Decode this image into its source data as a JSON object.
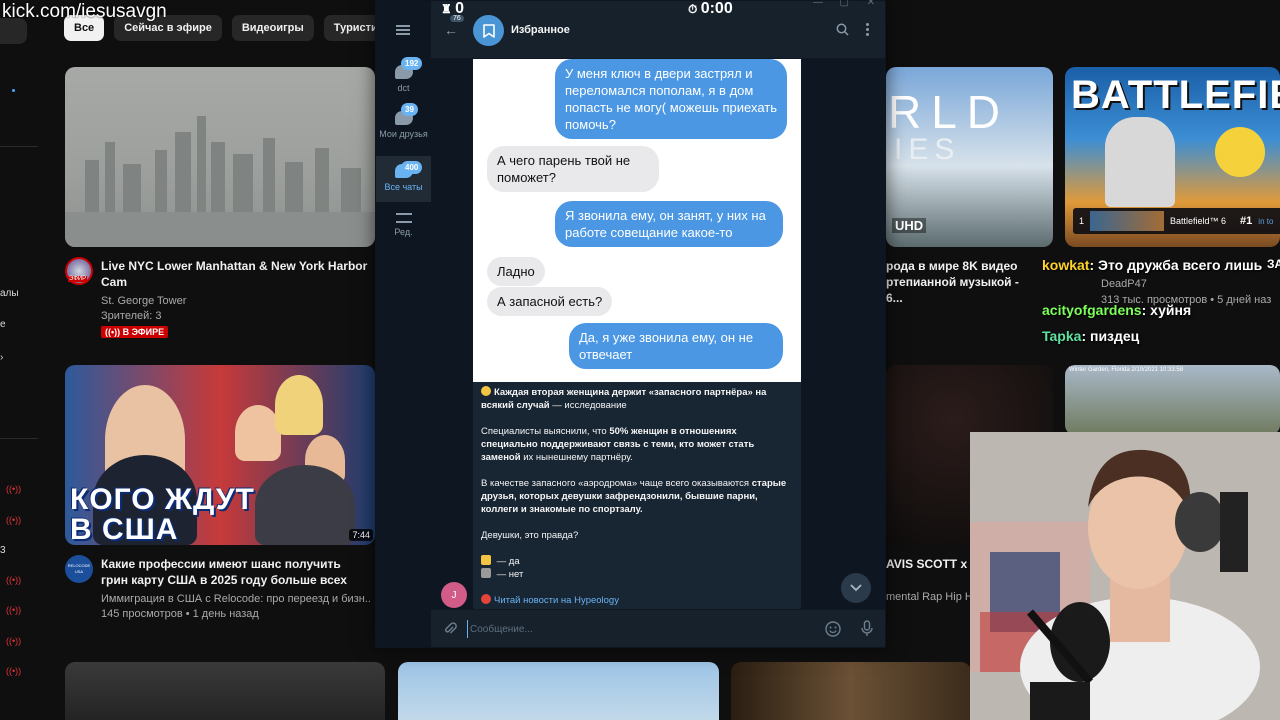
{
  "watermark": "kick.com/iesusavgn",
  "chips": [
    "Все",
    "Сейчас в эфире",
    "Видеоигры",
    "Туристическ"
  ],
  "rail": {
    "label_1": "алы",
    "label_2": "е",
    "label_3": "3"
  },
  "videos": [
    {
      "title": "Live NYC Lower Manhattan & New York Harbor Cam",
      "channel": "St. George Tower",
      "meta": "Зрителей: 3",
      "live_label": "((•)) В ЭФИРЕ",
      "avatar_label": "ЭФИР"
    },
    {
      "title": "Какие профессии имеют шанс получить грин карту США в 2025 году больше всех",
      "channel": "Иммиграция в США с Relocode: про переезд и бизн...",
      "meta": "145 просмотров • 1 день назад",
      "duration": "7:44",
      "thumb_text_1": "КОГО ЖДУТ",
      "thumb_text_2": "В США",
      "avatar_label": "RELOCODE USA"
    },
    {
      "title_partial": "рода в мире 8K видео ртепианной музыкой - 6...",
      "channel": "DeadP47",
      "meta": "313 тыс. просмотров • 5 дней наз",
      "thumb_text_1": "RLD",
      "thumb_text_2": "IES",
      "uhd": "UHD"
    },
    {
      "thumb_title": "BATTLEFIE",
      "rank": "1",
      "game": "Battlefield™ 6",
      "place": "#1",
      "place_suffix": "in to"
    },
    {
      "title_partial": "AVIS SCOTT x D",
      "meta_partial": "mental Rap Hip H"
    }
  ],
  "thumb_caption": "Winter Garden, Florida   2/10/2021 10:33:58",
  "chat": [
    {
      "user": "kowkat",
      "text": ": Это дружба всего лишь",
      "extra": "ЗА"
    },
    {
      "user": "acityofgardens",
      "text": ": хуйня"
    },
    {
      "user": "Tapka",
      "text": ": пиздец"
    }
  ],
  "overlay": {
    "counter": "0",
    "timer": "0:00"
  },
  "telegram": {
    "header_title": "Избранное",
    "back_badge": "76",
    "folders": [
      {
        "label": "dct",
        "badge": "192"
      },
      {
        "label": "Мои друзья",
        "badge": "39"
      },
      {
        "label": "Все чаты",
        "badge": "400"
      },
      {
        "label": "Ред."
      }
    ],
    "messages": [
      {
        "dir": "out",
        "text": "У меня ключ в двери застрял и переломался пополам, я в дом попасть не могу( можешь приехать помочь?"
      },
      {
        "dir": "in",
        "text": "А чего парень твой не поможет?"
      },
      {
        "dir": "out",
        "text": "Я звонила ему, он занят, у них на работе совещание какое-то"
      },
      {
        "dir": "in",
        "text": "Ладно"
      },
      {
        "dir": "in",
        "text": "А запасной есть?"
      },
      {
        "dir": "out",
        "text": "Да, я уже звонила ему, он не отвечает"
      }
    ],
    "post": {
      "headline_bold": "Каждая вторая женщина держит «запасного партнёра» на всякий случай",
      "headline_rest": " — исследование",
      "p2_a": "Специалисты выяснили, что ",
      "p2_b": "50% женщин в отношениях специально поддерживают связь с теми, кто может стать заменой",
      "p2_c": " их нынешнему партнёру.",
      "p3_a": "В качестве запасного «аэродрома» чаще всего оказываются ",
      "p3_b": "старые друзья, которых девушки зафрендзонили, бывшие парни, коллеги и знакомые по спортзалу.",
      "p4": "Девушки, это правда?",
      "vote_yes": " — да",
      "vote_no": " — нет",
      "link": "Читай новости на Hypeology"
    },
    "author_initial": "J",
    "compose_placeholder": "Сообщение..."
  },
  "colors": {
    "tg_accent": "#6ab3f3",
    "bubble_out": "#4b97e3",
    "bubble_in": "#e9e9eb",
    "live_red": "#cc0000"
  }
}
